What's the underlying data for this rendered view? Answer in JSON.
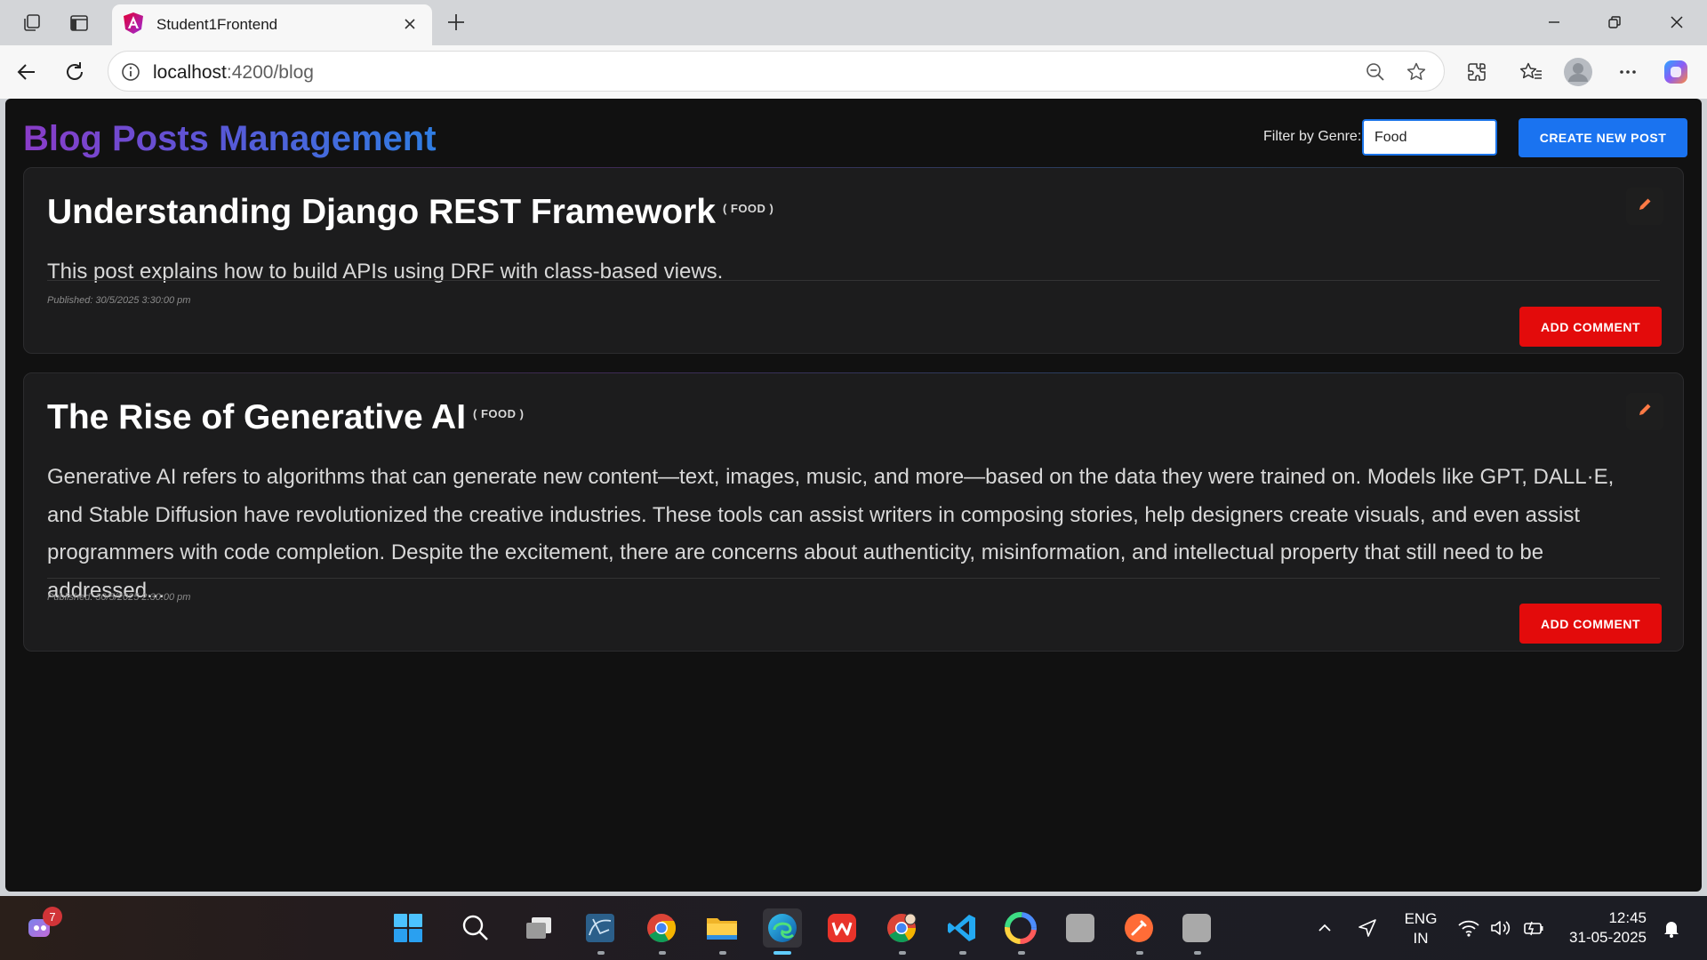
{
  "browser": {
    "tab_title": "Student1Frontend",
    "url_host": "localhost",
    "url_path": ":4200/blog"
  },
  "page": {
    "title": "Blog Posts Management",
    "filter_label": "Filter by Genre:",
    "filter_value": "Food",
    "create_button": "CREATE NEW POST"
  },
  "posts": [
    {
      "title": "Understanding Django REST Framework",
      "genre": "( FOOD )",
      "body": "This post explains how to build APIs using DRF with class-based views.",
      "published": "Published: 30/5/2025 3:30:00 pm",
      "comment_button": "ADD COMMENT"
    },
    {
      "title": "The Rise of Generative AI",
      "genre": "( FOOD )",
      "body": "Generative AI refers to algorithms that can generate new content—text, images, music, and more—based on the data they were trained on. Models like GPT, DALL·E, and Stable Diffusion have revolutionized the creative industries. These tools can assist writers in composing stories, help designers create visuals, and even assist programmers with code completion. Despite the excitement, there are concerns about authenticity, misinformation, and intellectual property that still need to be addressed...",
      "published": "Published: 30/5/2025 2:30:00 pm",
      "comment_button": "ADD COMMENT"
    }
  ],
  "taskbar": {
    "notification_count": "7",
    "lang_line1": "ENG",
    "lang_line2": "IN",
    "time": "12:45",
    "date": "31-05-2025"
  },
  "colors": {
    "primary_button": "#1a73f0",
    "comment_button": "#e30b0b",
    "edit_icon": "#ff7a45",
    "page_background": "#111111",
    "card_background": "#1c1c1d"
  }
}
